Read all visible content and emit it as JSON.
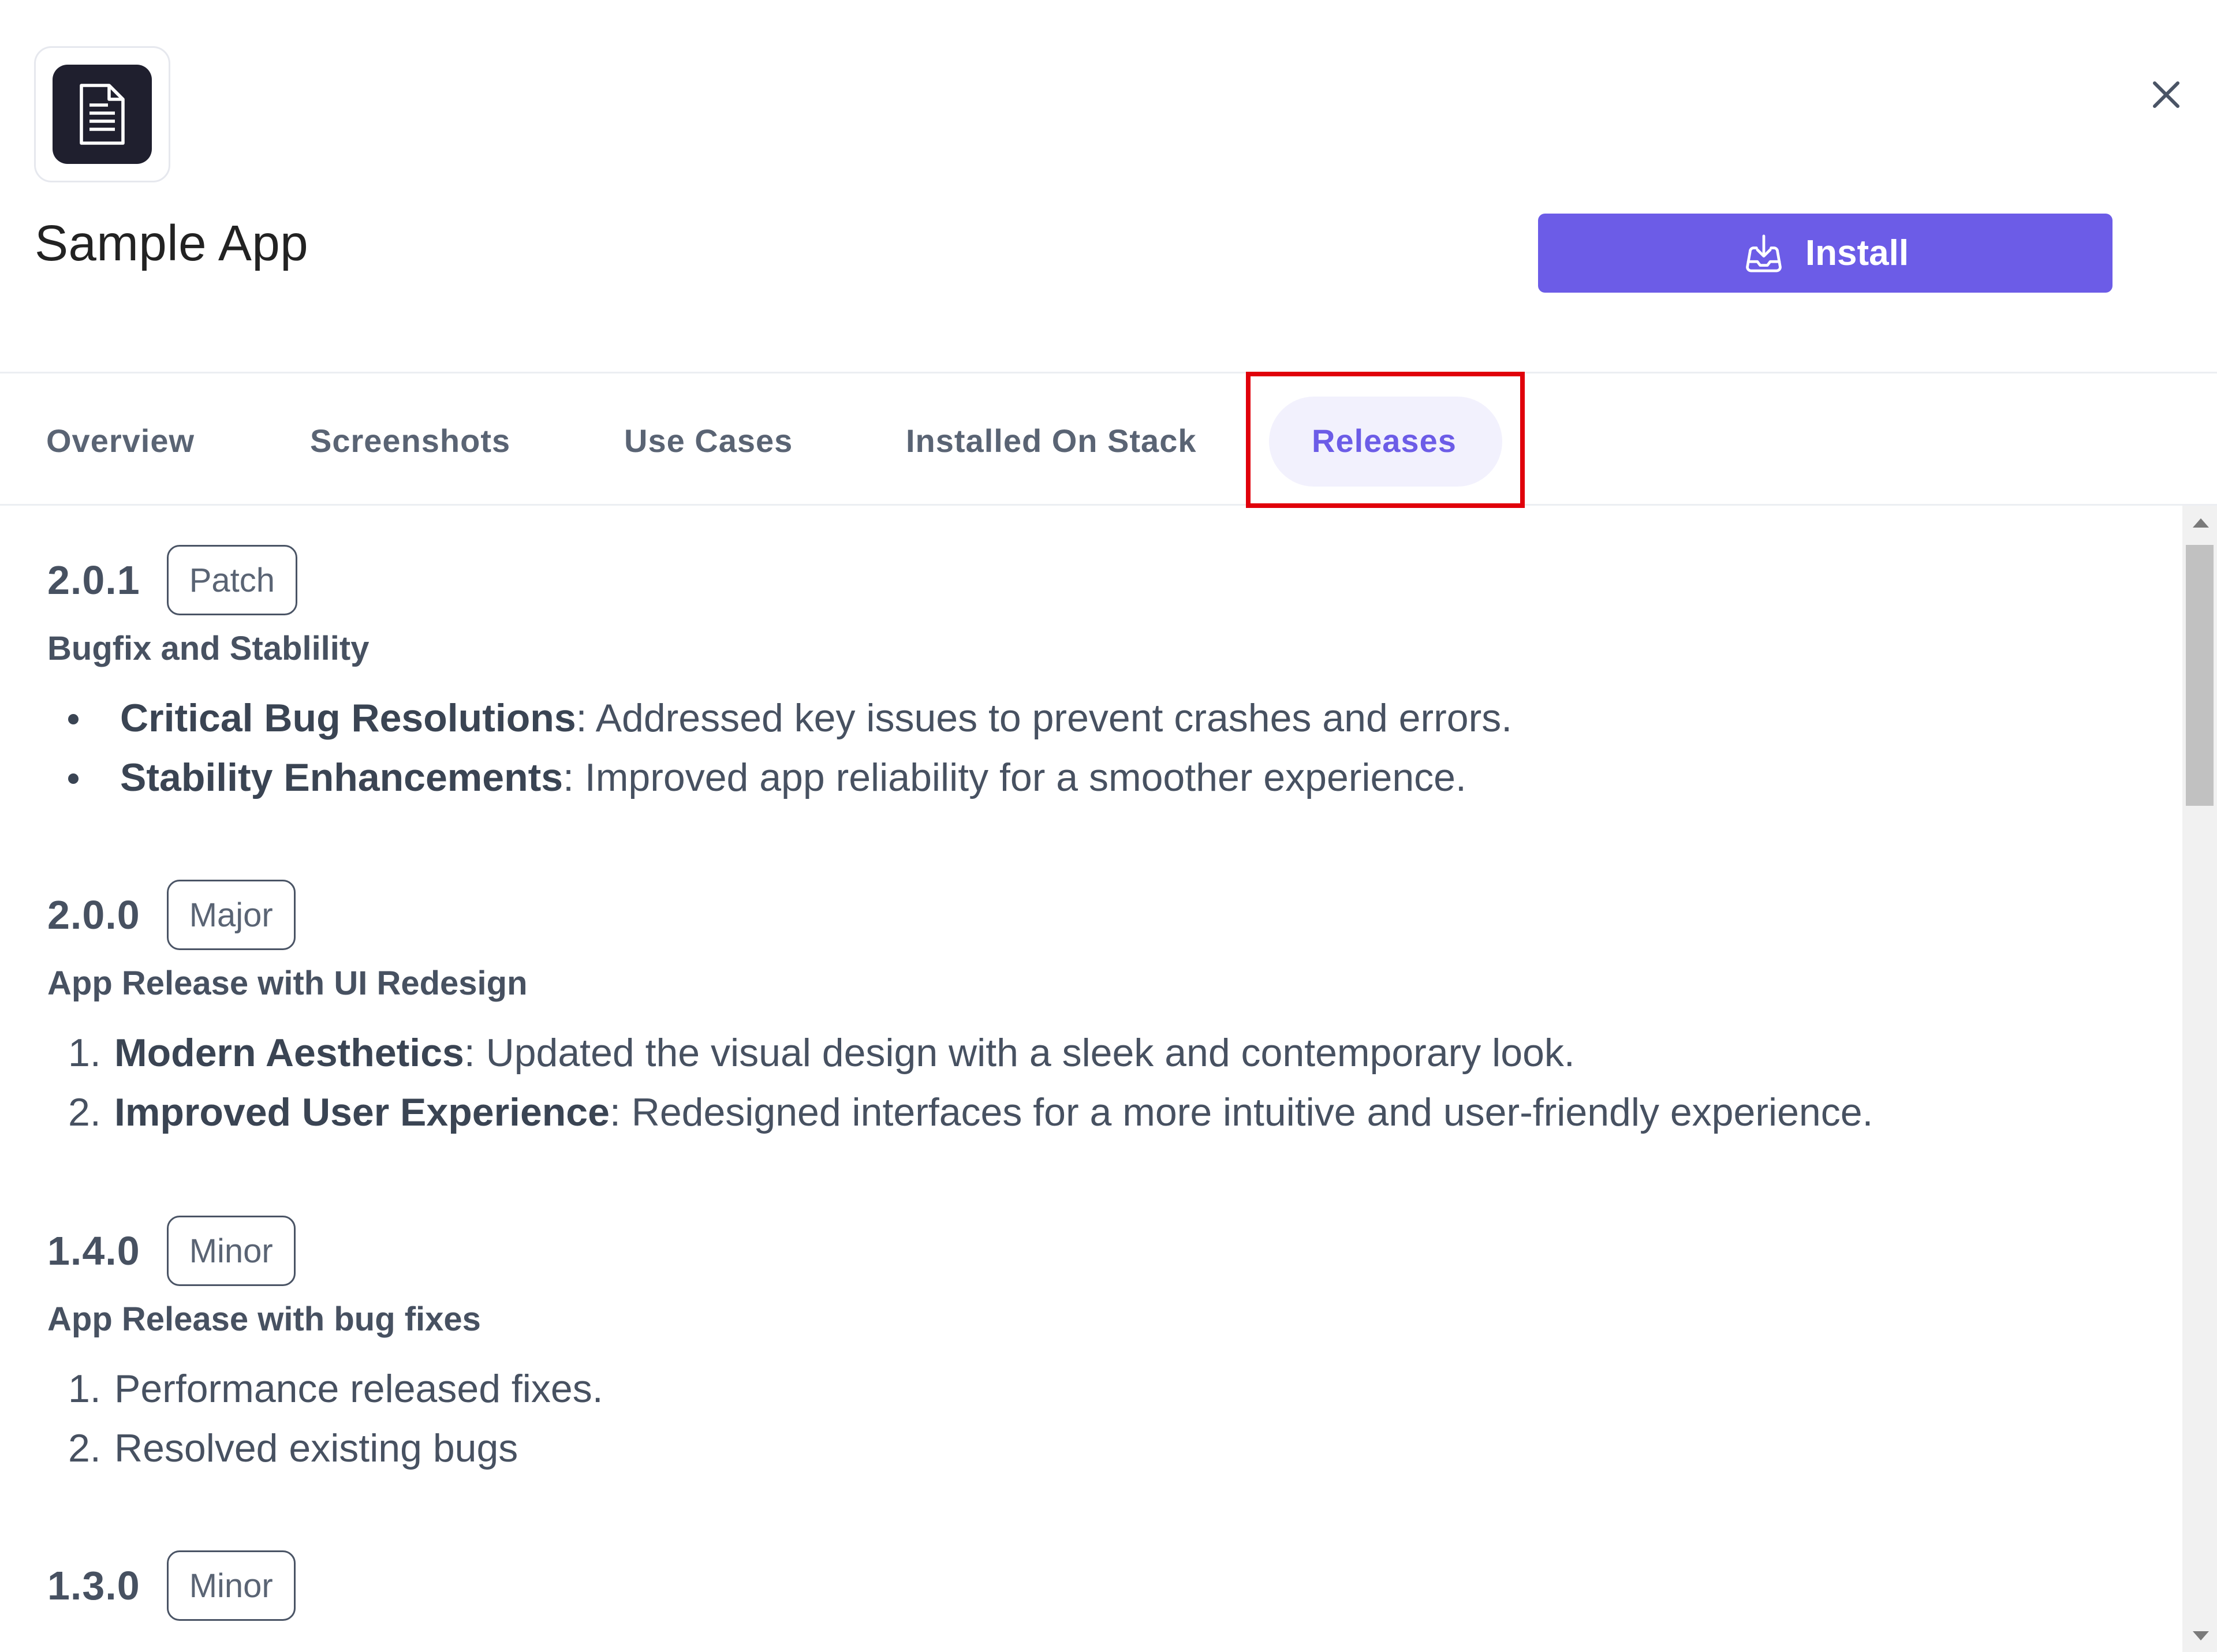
{
  "header": {
    "app_title": "Sample App",
    "install_label": "Install",
    "logo_icon": "document-icon",
    "close_icon": "close-icon",
    "accent_color": "#6c5ce7"
  },
  "tabs": [
    {
      "label": "Overview"
    },
    {
      "label": "Screenshots"
    },
    {
      "label": "Use Cases"
    },
    {
      "label": "Installed On Stack"
    },
    {
      "label": "Releases",
      "active": true
    }
  ],
  "releases": [
    {
      "version": "2.0.1",
      "badge": "Patch",
      "subtitle": "Bugfix and Stablility",
      "list_type": "bullet",
      "items": [
        {
          "bold": "Critical Bug Resolutions",
          "text": ": Addressed key issues to prevent crashes and errors."
        },
        {
          "bold": "Stability Enhancements",
          "text": ": Improved app reliability for a smoother experience."
        }
      ]
    },
    {
      "version": "2.0.0",
      "badge": "Major",
      "subtitle": "App Release with UI Redesign",
      "list_type": "numbered",
      "items": [
        {
          "num": "1.",
          "bold": "Modern Aesthetics",
          "text": ": Updated the visual design with a sleek and contemporary look."
        },
        {
          "num": "2.",
          "bold": "Improved User Experience",
          "text": ": Redesigned interfaces for a more intuitive and user-friendly experience."
        }
      ]
    },
    {
      "version": "1.4.0",
      "badge": "Minor",
      "subtitle": "App Release with bug fixes",
      "list_type": "numbered",
      "items": [
        {
          "num": "1.",
          "text": "Performance released fixes."
        },
        {
          "num": "2.",
          "text": "Resolved existing bugs"
        }
      ]
    },
    {
      "version": "1.3.0",
      "badge": "Minor"
    }
  ]
}
